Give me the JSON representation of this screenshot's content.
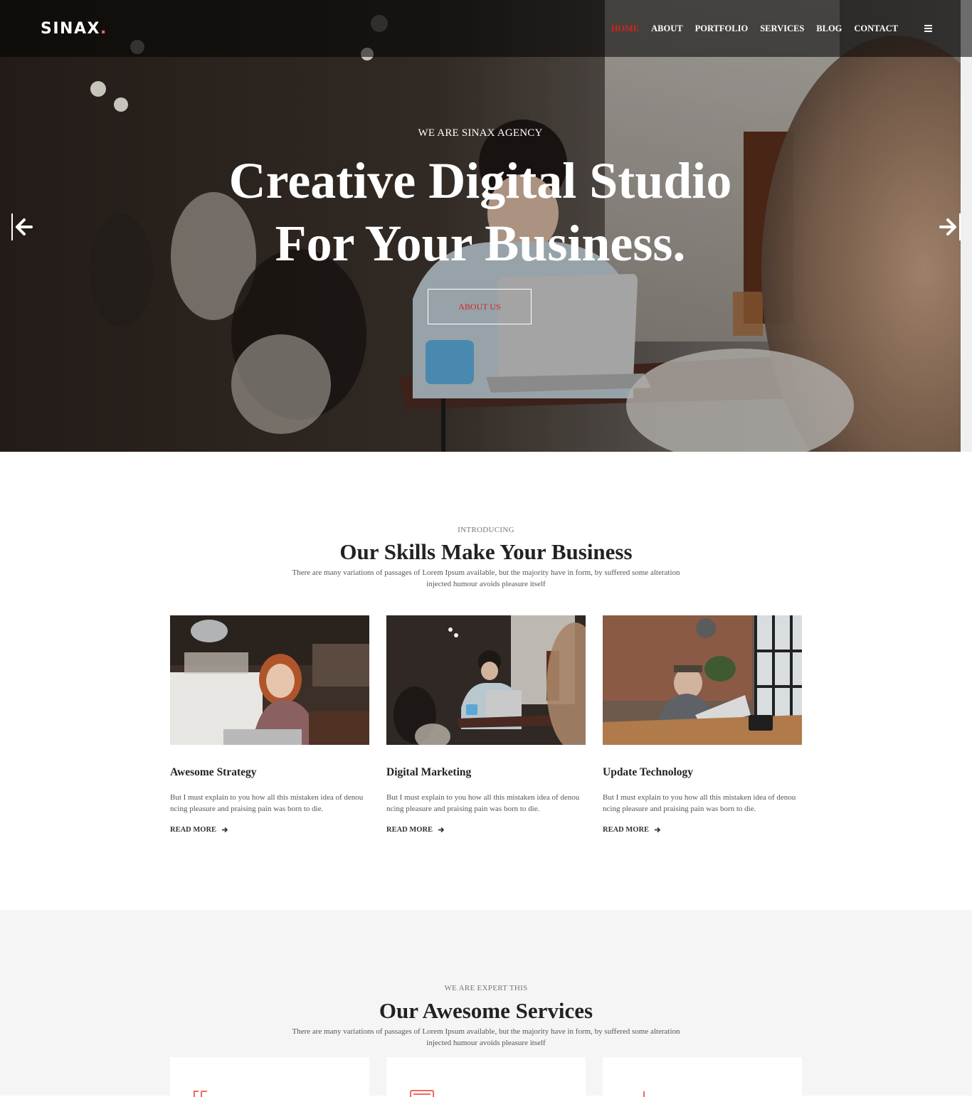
{
  "brand": {
    "name": "SINAX",
    "dot": ".",
    "accent": "#f2685e",
    "active_color": "#d4231d"
  },
  "nav": {
    "items": [
      {
        "label": "HOME",
        "active": true
      },
      {
        "label": "ABOUT"
      },
      {
        "label": "PORTFOLIO"
      },
      {
        "label": "SERVICES"
      },
      {
        "label": "BLOG"
      },
      {
        "label": "CONTACT"
      }
    ],
    "menu_icon": "hamburger-icon"
  },
  "hero": {
    "kicker": "WE ARE SINAX AGENCY",
    "title_line1": "Creative Digital Studio",
    "title_line2": "For Your Business.",
    "button": "ABOUT US",
    "prev_icon": "arrow-left-icon",
    "next_icon": "arrow-right-icon"
  },
  "skills": {
    "kicker": "INTRODUCING",
    "title": "Our Skills Make Your Business",
    "desc_line1": "There are many variations of passages of Lorem Ipsum available, but the majority have in form, by suffered some alteration",
    "desc_line2": "injected humour avoids pleasure itself",
    "cards": [
      {
        "title": "Awesome Strategy",
        "text_line1": "But I must explain to you how all this mistaken idea of denou",
        "text_line2": "ncing pleasure and praising pain was born to die.",
        "link": "READ MORE"
      },
      {
        "title": "Digital Marketing",
        "text_line1": "But I must explain to you how all this mistaken idea of denou",
        "text_line2": "ncing pleasure and praising pain was born to die.",
        "link": "READ MORE"
      },
      {
        "title": "Update Technology",
        "text_line1": "But I must explain to you how all this mistaken idea of denou",
        "text_line2": "ncing pleasure and praising pain was born to die.",
        "link": "READ MORE"
      }
    ]
  },
  "services": {
    "kicker": "WE ARE EXPERT THIS",
    "title": "Our Awesome Services",
    "desc_line1": "There are many variations of passages of Lorem Ipsum available, but the majority have in form, by suffered some alteration",
    "desc_line2": "injected humour avoids pleasure itself"
  }
}
